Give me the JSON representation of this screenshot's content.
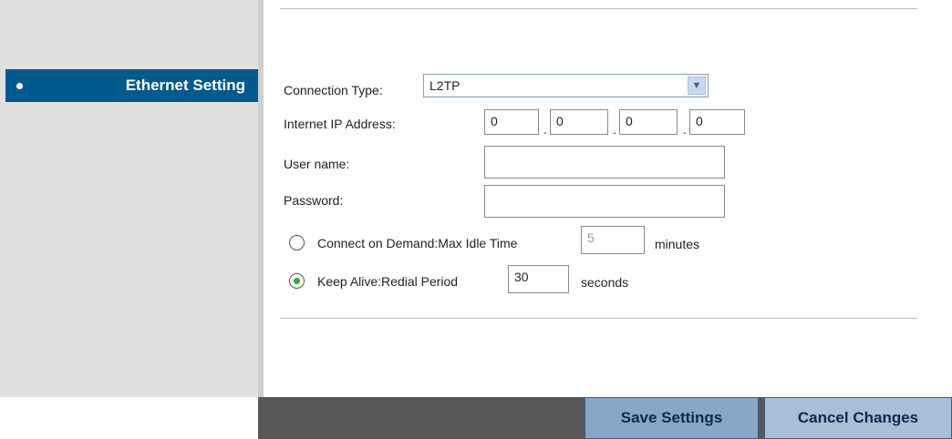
{
  "sidebar": {
    "items": [
      {
        "label": "Ethernet Setting"
      }
    ]
  },
  "form": {
    "connection_type": {
      "label": "Connection Type:",
      "value": "L2TP"
    },
    "internet_ip": {
      "label": "Internet IP Address:",
      "octets": [
        "0",
        "0",
        "0",
        "0"
      ]
    },
    "username": {
      "label": "User name:",
      "value": ""
    },
    "password": {
      "label": "Password:",
      "value": ""
    },
    "connect_on_demand": {
      "label": "Connect on Demand:Max Idle Time",
      "value": "5",
      "unit": "minutes",
      "selected": false
    },
    "keep_alive": {
      "label": "Keep Alive:Redial Period",
      "value": "30",
      "unit": "seconds",
      "selected": true
    }
  },
  "footer": {
    "save_label": "Save Settings",
    "cancel_label": "Cancel Changes"
  },
  "icons": {
    "dropdown": "chevron-down-icon"
  },
  "colors": {
    "sidebar_active": "#015a8e",
    "footer_bg": "#575757",
    "save_bg": "#88a6c6",
    "cancel_bg": "#a9bfd6"
  }
}
